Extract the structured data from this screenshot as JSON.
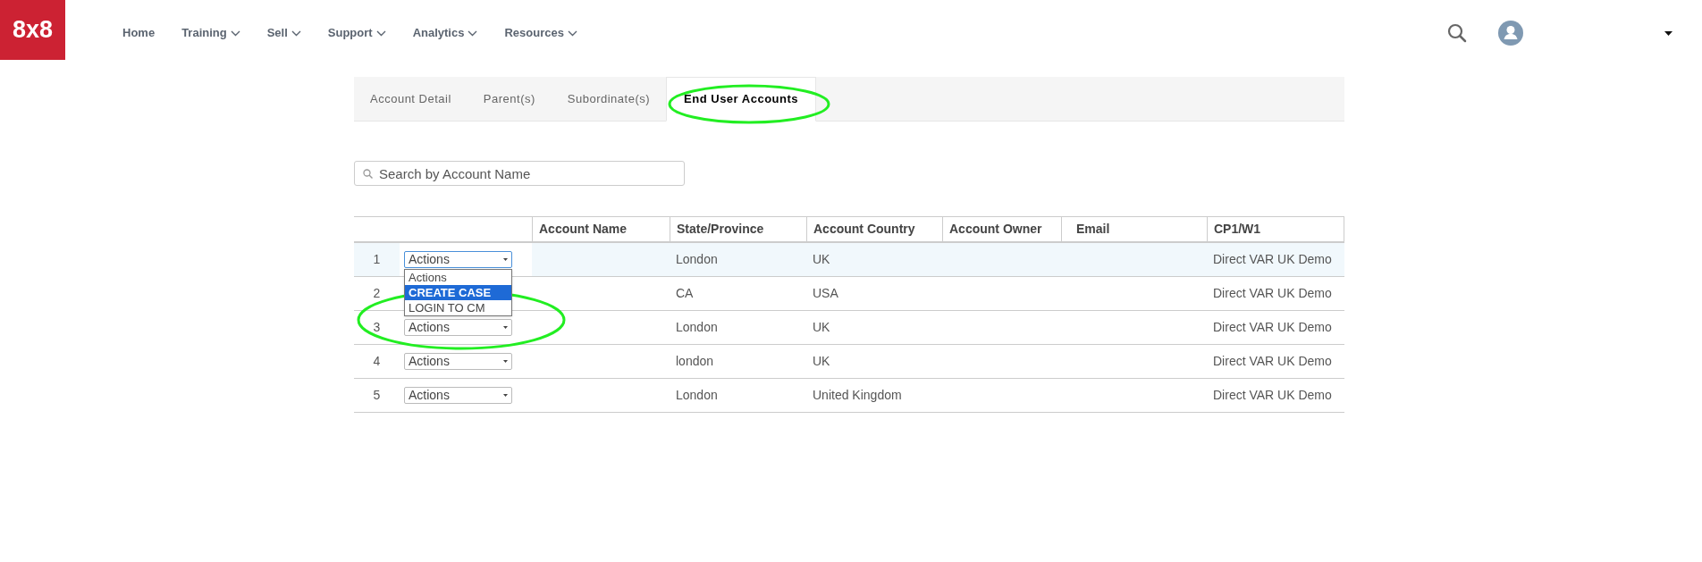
{
  "logo": "8x8",
  "nav": [
    {
      "label": "Home",
      "has_menu": false
    },
    {
      "label": "Training",
      "has_menu": true
    },
    {
      "label": "Sell",
      "has_menu": true
    },
    {
      "label": "Support",
      "has_menu": true
    },
    {
      "label": "Analytics",
      "has_menu": true
    },
    {
      "label": "Resources",
      "has_menu": true
    }
  ],
  "tabs": [
    {
      "label": "Account Detail",
      "selected": false,
      "circled": false
    },
    {
      "label": "Parent(s)",
      "selected": false,
      "circled": false
    },
    {
      "label": "Subordinate(s)",
      "selected": false,
      "circled": false
    },
    {
      "label": "End User Accounts",
      "selected": true,
      "circled": true
    }
  ],
  "search": {
    "placeholder": "Search by Account Name"
  },
  "table": {
    "columns": [
      "Account Name",
      "State/Province",
      "Account Country",
      "Account Owner",
      "Email",
      "CP1/W1"
    ],
    "rows": [
      {
        "index": "1",
        "selected": true,
        "action": "Actions",
        "state_province": "London",
        "account_country": "UK",
        "cp1_w1": "Direct VAR UK Demo",
        "open_menu": {
          "circled": true,
          "options": [
            {
              "label": "Actions",
              "selected": false
            },
            {
              "label": "CREATE CASE",
              "selected": true
            },
            {
              "label": "LOGIN TO CM",
              "selected": false
            }
          ]
        }
      },
      {
        "index": "2",
        "selected": false,
        "state_province": "CA",
        "account_country": "USA",
        "cp1_w1": "Direct VAR UK Demo"
      },
      {
        "index": "3",
        "selected": false,
        "action": "Actions",
        "state_province": "London",
        "account_country": "UK",
        "cp1_w1": "Direct VAR UK Demo"
      },
      {
        "index": "4",
        "selected": false,
        "action": "Actions",
        "state_province": "london",
        "account_country": "UK",
        "cp1_w1": "Direct VAR UK Demo"
      },
      {
        "index": "5",
        "selected": false,
        "action": "Actions",
        "state_province": "London",
        "account_country": "United Kingdom",
        "cp1_w1": "Direct VAR UK Demo"
      }
    ]
  }
}
